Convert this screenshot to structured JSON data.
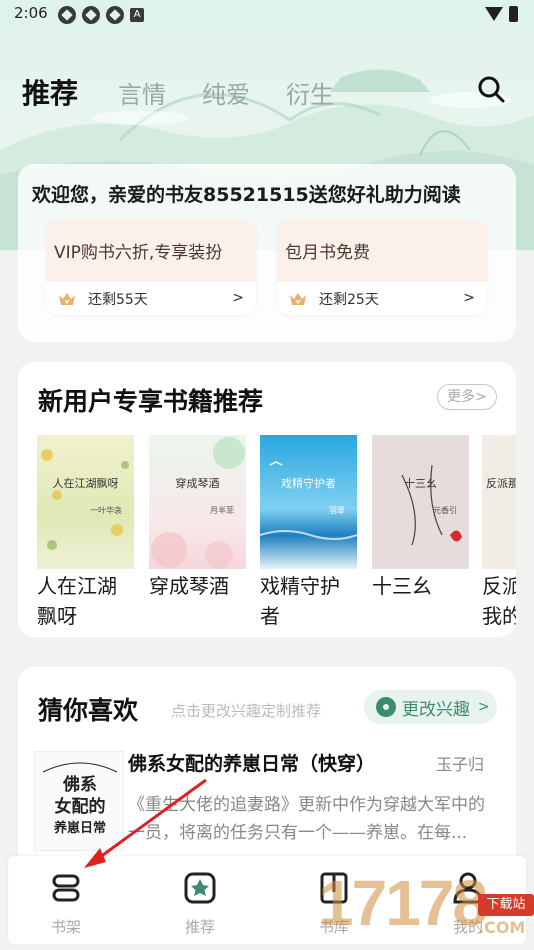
{
  "status_bar": {
    "time": "2:06",
    "badge_letter": "A"
  },
  "top_tabs": [
    {
      "label": "推荐",
      "active": true
    },
    {
      "label": "言情",
      "active": false
    },
    {
      "label": "纯爱",
      "active": false
    },
    {
      "label": "衍生",
      "active": false
    }
  ],
  "welcome": {
    "text": "欢迎您，亲爱的书友85521515送您好礼助力阅读",
    "perks": [
      {
        "title": "VIP购书六折,专享装扮",
        "remaining": "还剩55天",
        "arrow": ">"
      },
      {
        "title": "包月书免费",
        "remaining": "还剩25天",
        "arrow": ">"
      }
    ]
  },
  "new_user": {
    "title": "新用户专享书籍推荐",
    "more_label": "更多>",
    "books": [
      {
        "title": "人在江湖飘呀",
        "cover_title": "人在江湖飘呀",
        "cover_author": "一叶华衾"
      },
      {
        "title": "穿成琴酒",
        "cover_title": "穿成琴酒",
        "cover_author": "月半菲"
      },
      {
        "title": "戏精守护者",
        "cover_title": "戏精守护者",
        "cover_author": "羽翠"
      },
      {
        "title": "十三幺",
        "cover_title": "十三幺",
        "cover_author": "元香引"
      },
      {
        "title": "反派我的",
        "cover_title": "反派那",
        "cover_author": ""
      }
    ]
  },
  "guess": {
    "title": "猜你喜欢",
    "hint": "点击更改兴趣定制推荐",
    "interest_label": "更改兴趣",
    "interest_arrow": ">",
    "item": {
      "cover_text": "佛系女配的养崽日常",
      "title": "佛系女配的养崽日常（快穿）",
      "author": "玉子归",
      "desc": "《重生大佬的追妻路》更新中作为穿越大军中的一员，将离的任务只有一个——养崽。在每..."
    }
  },
  "bottom_nav": [
    {
      "label": "书架",
      "icon": "bookshelf-icon",
      "active": false
    },
    {
      "label": "推荐",
      "icon": "recommend-star-icon",
      "active": true
    },
    {
      "label": "书库",
      "icon": "book-library-icon",
      "active": false
    },
    {
      "label": "我的",
      "icon": "user-profile-icon",
      "active": false
    }
  ],
  "watermark": {
    "text": "17178",
    "badge": "下载站",
    "suffix": ".COM"
  },
  "colors": {
    "accent": "#3c8c6c",
    "annotation_arrow": "#e02020"
  }
}
